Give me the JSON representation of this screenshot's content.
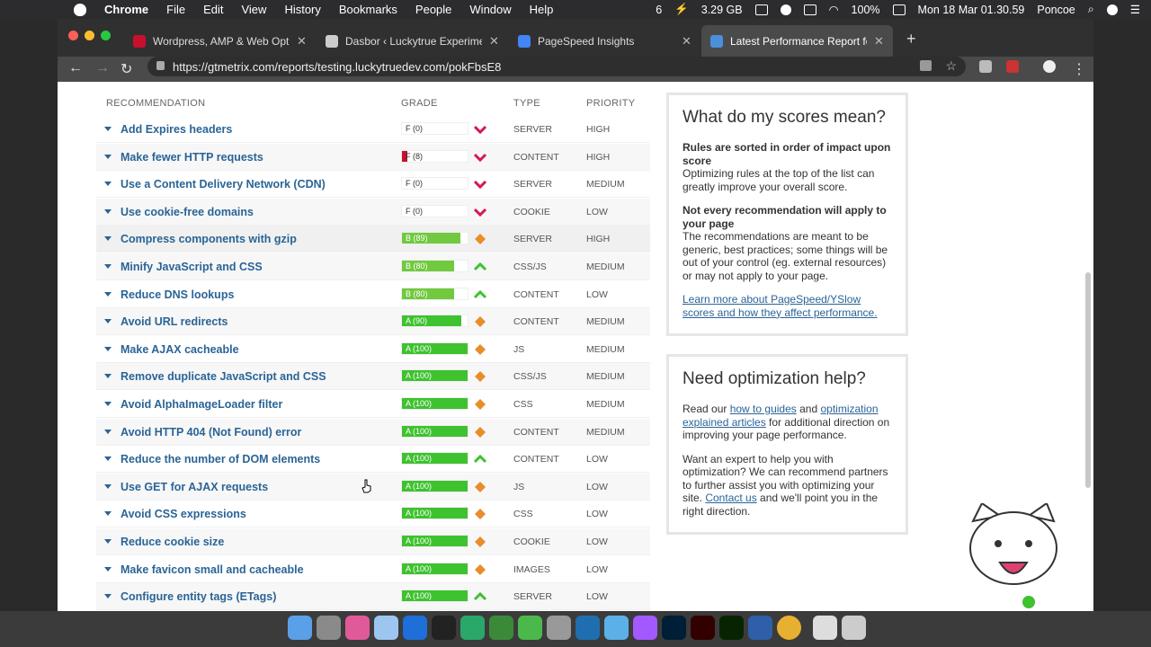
{
  "menubar": {
    "app": "Chrome",
    "items": [
      "File",
      "Edit",
      "View",
      "History",
      "Bookmarks",
      "People",
      "Window",
      "Help"
    ],
    "status": {
      "count": "6",
      "memory": "3.29 GB",
      "battery": "100%",
      "datetime": "Mon 18 Mar  01.30.59",
      "user": "Poncoe"
    }
  },
  "tabs": [
    {
      "title": "Wordpress, AMP & Web Optim",
      "color": "#c8102e",
      "active": false
    },
    {
      "title": "Dasbor ‹ Luckytrue Experimen",
      "color": "#cccccc",
      "active": false
    },
    {
      "title": "PageSpeed Insights",
      "color": "#4285f4",
      "active": false
    },
    {
      "title": "Latest Performance Report for",
      "color": "#4a90d9",
      "active": true
    }
  ],
  "toolbar": {
    "url": "https://gtmetrix.com/reports/testing.luckytruedev.com/pokFbsE8"
  },
  "table": {
    "headers": {
      "recommendation": "RECOMMENDATION",
      "grade": "GRADE",
      "type": "TYPE",
      "priority": "PRIORITY"
    },
    "rows": [
      {
        "name": "Add Expires headers",
        "grade": "F (0)",
        "score": 0,
        "trend": "down",
        "type": "SERVER",
        "priority": "HIGH"
      },
      {
        "name": "Make fewer HTTP requests",
        "grade": "F (8)",
        "score": 8,
        "trend": "down",
        "type": "CONTENT",
        "priority": "HIGH"
      },
      {
        "name": "Use a Content Delivery Network (CDN)",
        "grade": "F (0)",
        "score": 0,
        "trend": "down",
        "type": "SERVER",
        "priority": "MEDIUM"
      },
      {
        "name": "Use cookie-free domains",
        "grade": "F (0)",
        "score": 0,
        "trend": "down",
        "type": "COOKIE",
        "priority": "LOW"
      },
      {
        "name": "Compress components with gzip",
        "grade": "B (89)",
        "score": 89,
        "trend": "same",
        "type": "SERVER",
        "priority": "HIGH"
      },
      {
        "name": "Minify JavaScript and CSS",
        "grade": "B (80)",
        "score": 80,
        "trend": "up",
        "type": "CSS/JS",
        "priority": "MEDIUM"
      },
      {
        "name": "Reduce DNS lookups",
        "grade": "B (80)",
        "score": 80,
        "trend": "up",
        "type": "CONTENT",
        "priority": "LOW"
      },
      {
        "name": "Avoid URL redirects",
        "grade": "A (90)",
        "score": 90,
        "trend": "same",
        "type": "CONTENT",
        "priority": "MEDIUM"
      },
      {
        "name": "Make AJAX cacheable",
        "grade": "A (100)",
        "score": 100,
        "trend": "same",
        "type": "JS",
        "priority": "MEDIUM"
      },
      {
        "name": "Remove duplicate JavaScript and CSS",
        "grade": "A (100)",
        "score": 100,
        "trend": "same",
        "type": "CSS/JS",
        "priority": "MEDIUM"
      },
      {
        "name": "Avoid AlphaImageLoader filter",
        "grade": "A (100)",
        "score": 100,
        "trend": "same",
        "type": "CSS",
        "priority": "MEDIUM"
      },
      {
        "name": "Avoid HTTP 404 (Not Found) error",
        "grade": "A (100)",
        "score": 100,
        "trend": "same",
        "type": "CONTENT",
        "priority": "MEDIUM"
      },
      {
        "name": "Reduce the number of DOM elements",
        "grade": "A (100)",
        "score": 100,
        "trend": "up",
        "type": "CONTENT",
        "priority": "LOW"
      },
      {
        "name": "Use GET for AJAX requests",
        "grade": "A (100)",
        "score": 100,
        "trend": "same",
        "type": "JS",
        "priority": "LOW"
      },
      {
        "name": "Avoid CSS expressions",
        "grade": "A (100)",
        "score": 100,
        "trend": "same",
        "type": "CSS",
        "priority": "LOW"
      },
      {
        "name": "Reduce cookie size",
        "grade": "A (100)",
        "score": 100,
        "trend": "same",
        "type": "COOKIE",
        "priority": "LOW"
      },
      {
        "name": "Make favicon small and cacheable",
        "grade": "A (100)",
        "score": 100,
        "trend": "same",
        "type": "IMAGES",
        "priority": "LOW"
      },
      {
        "name": "Configure entity tags (ETags)",
        "grade": "A (100)",
        "score": 100,
        "trend": "up",
        "type": "SERVER",
        "priority": "LOW"
      }
    ]
  },
  "scores_box": {
    "title": "What do my scores mean?",
    "p1_bold": "Rules are sorted in order of impact upon score",
    "p1_text": "Optimizing rules at the top of the list can greatly improve your overall score.",
    "p2_bold": "Not every recommendation will apply to your page",
    "p2_text": "The recommendations are meant to be generic, best practices; some things will be out of your control (eg. external resources) or may not apply to your page.",
    "link": "Learn more about PageSpeed/YSlow scores and how they affect performance."
  },
  "help_box": {
    "title": "Need optimization help?",
    "p1_a": "Read our ",
    "p1_link1": "how to guides",
    "p1_b": " and ",
    "p1_link2": "optimization explained articles",
    "p1_c": " for additional direction on improving your page performance.",
    "p2_a": "Want an expert to help you with optimization? We can recommend partners to further assist you with optimizing your site. ",
    "p2_link": "Contact us",
    "p2_b": " and we'll point you in the right direction."
  },
  "colors": {
    "grade_a": "#3ec22f",
    "grade_b": "#70c93f",
    "grade_f": "#c8102e",
    "trend_down": "#d6194c",
    "trend_same": "#e88d2a",
    "trend_up": "#3ec22f",
    "link": "#2a6496"
  }
}
